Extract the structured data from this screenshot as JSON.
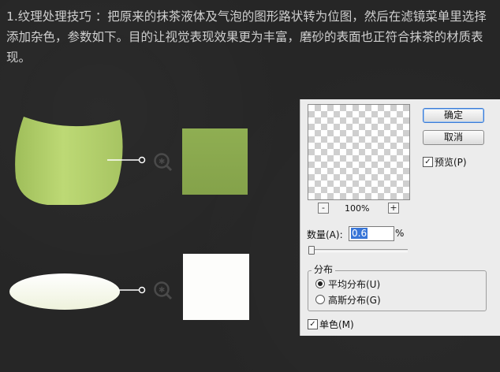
{
  "article": {
    "paragraph": "1.纹理处理技巧 ：把原来的抹茶液体及气泡的图形路状转为位图，然后在滤镜菜单里选择添加杂色，参数如下。目的让视觉表现效果更为丰富，磨砂的表面也正符合抹茶的材质表现。"
  },
  "colors": {
    "background": "#262626",
    "cup_green_light": "#b8d46e",
    "cup_green_dark": "#9fbf5c",
    "swatch_green": "#8aa84e",
    "bubble_white": "#fbfcf2",
    "dialog_bg": "#ececec",
    "selection_blue": "#3875d7"
  },
  "icons": {
    "zoom": "magnifier-icon"
  },
  "dialog": {
    "ok_label": "确定",
    "cancel_label": "取消",
    "preview_label": "预览(P)",
    "preview_checked": true,
    "zoom_out_label": "-",
    "zoom_in_label": "+",
    "zoom_level": "100%",
    "amount_label": "数量(A):",
    "amount_value": "0.6",
    "amount_unit": "%",
    "distribution_label": "分布",
    "uniform_label": "平均分布(U)",
    "gaussian_label": "高斯分布(G)",
    "selected_distribution": "uniform",
    "monochrome_label": "单色(M)",
    "monochrome_checked": true
  }
}
